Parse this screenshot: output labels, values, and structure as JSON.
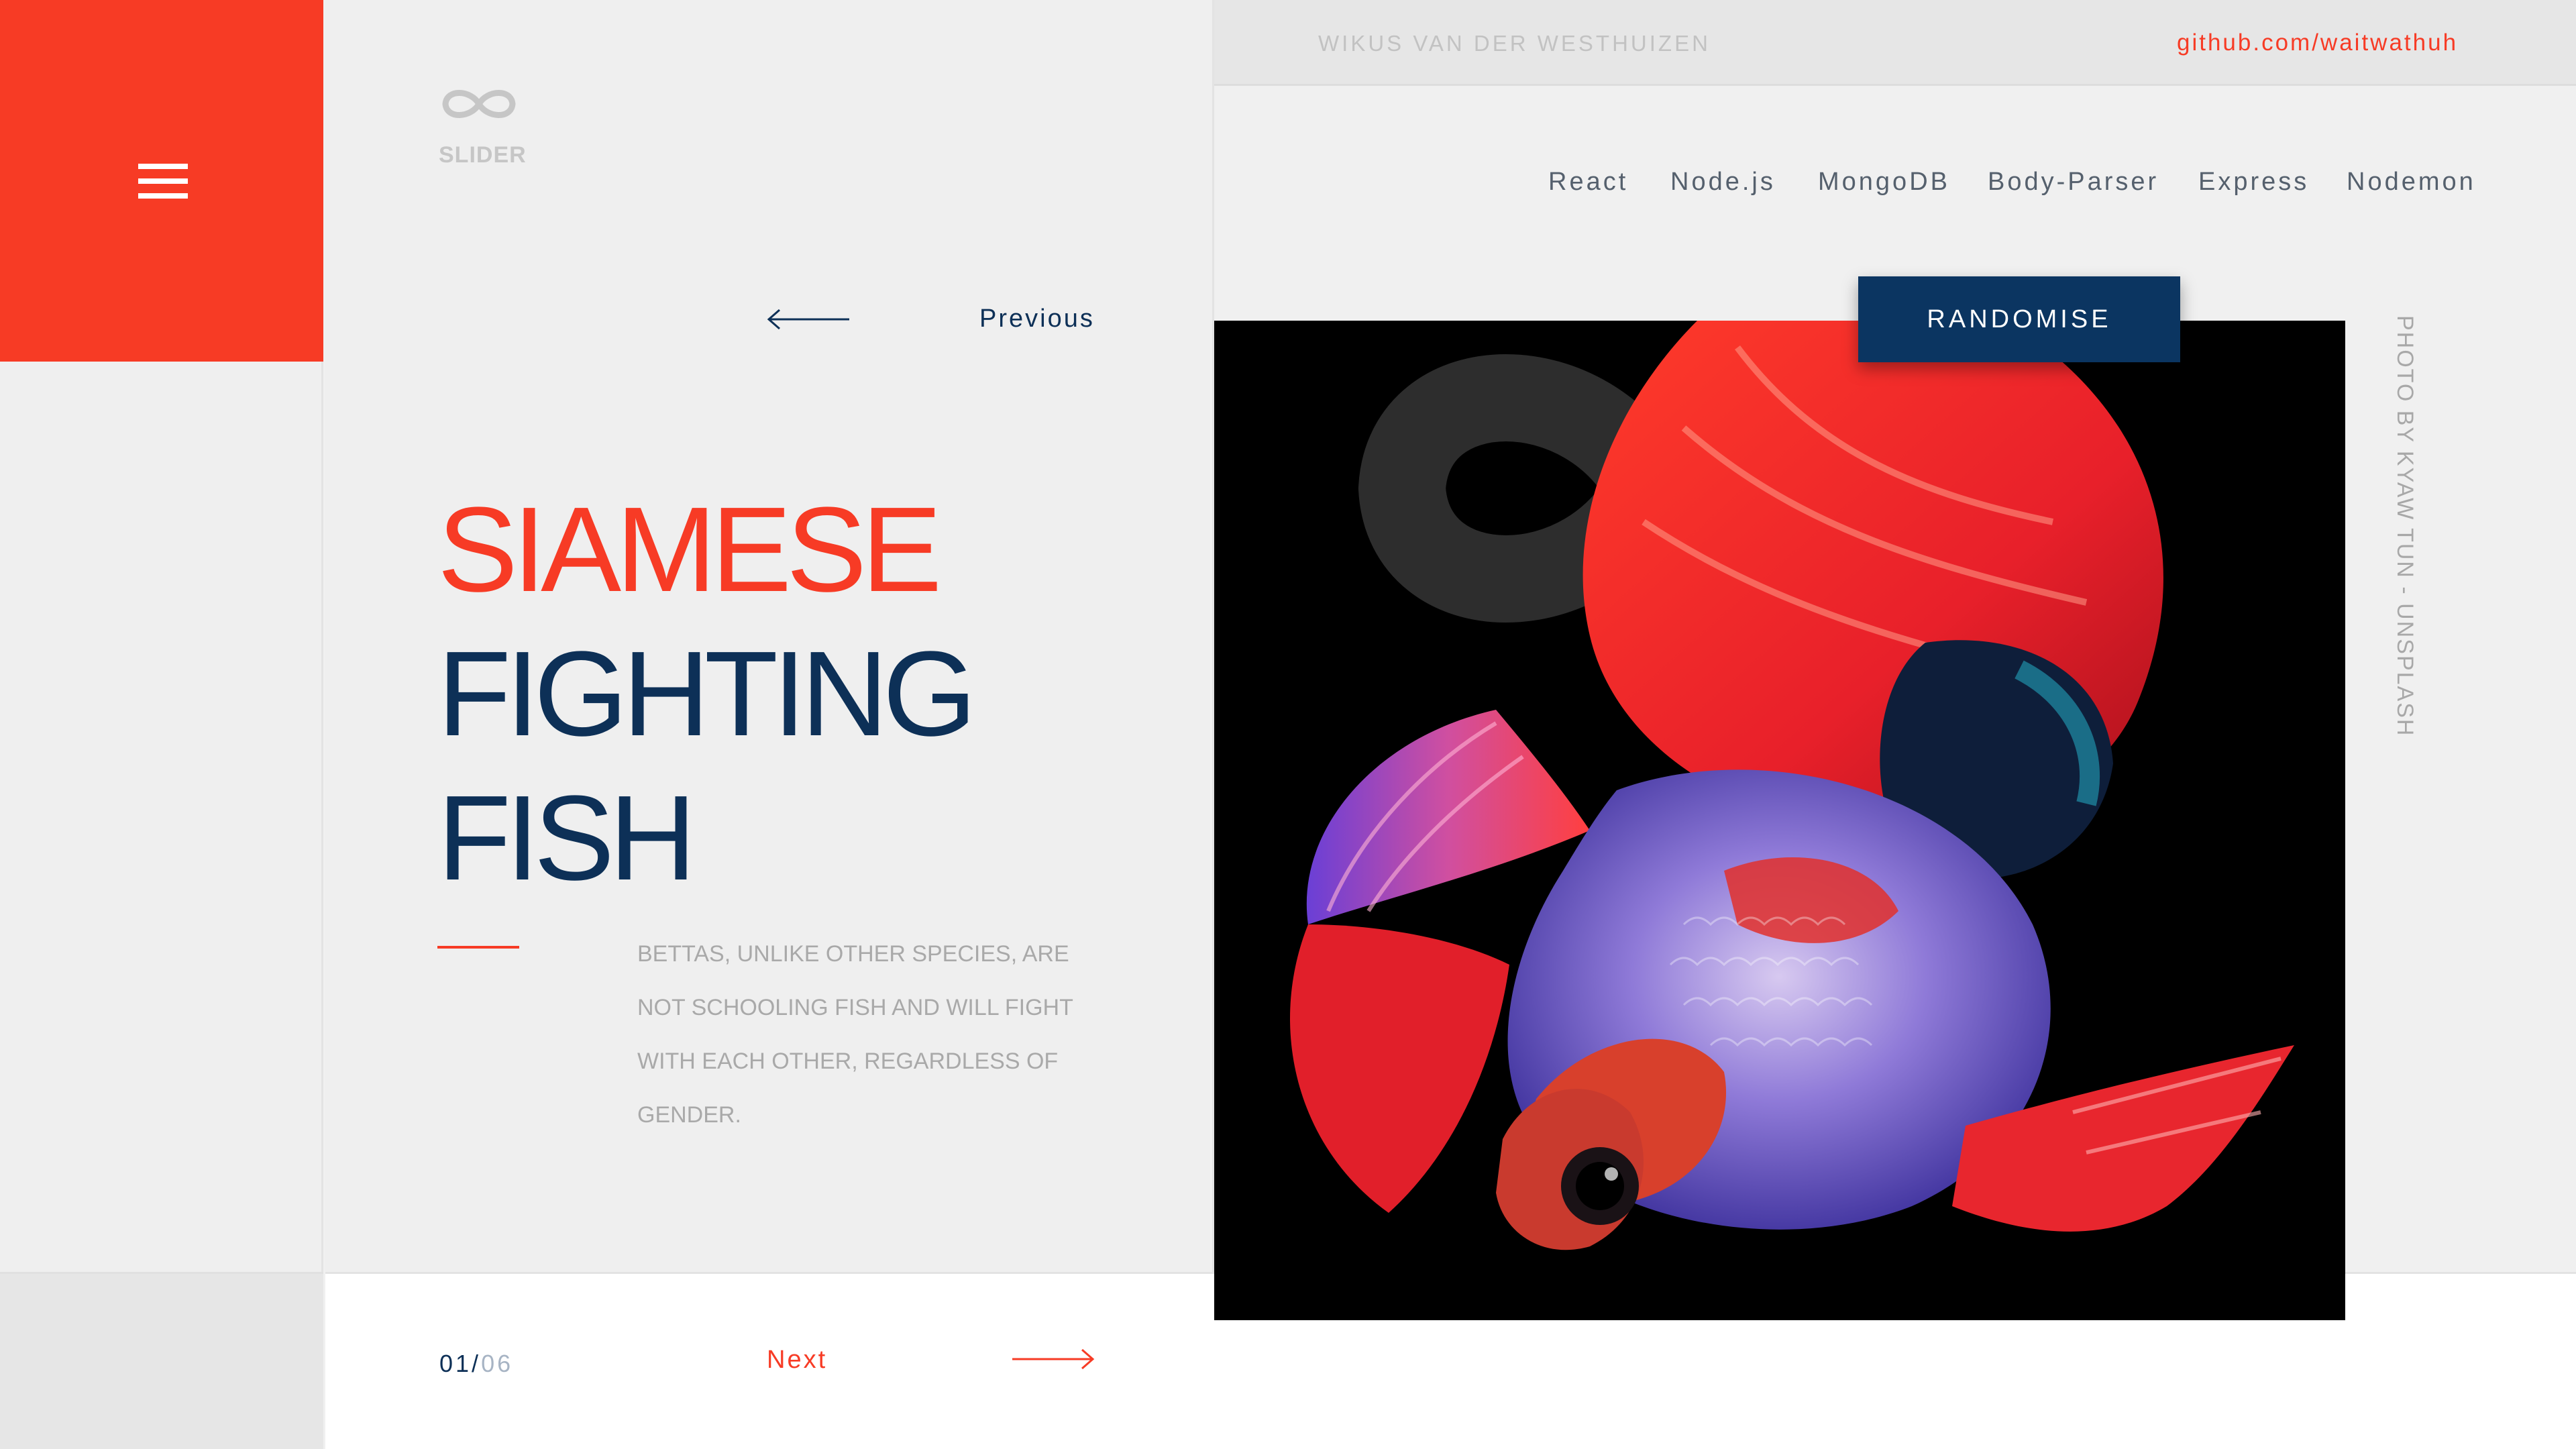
{
  "menu": {
    "icon": "hamburger-menu-icon"
  },
  "logo": {
    "icon": "infinity-icon",
    "text": "SLIDER"
  },
  "header": {
    "author": "WIKUS VAN DER WESTHUIZEN",
    "github": "github.com/waitwathuh"
  },
  "nav": {
    "items": [
      "React",
      "Node.js",
      "MongoDB",
      "Body-Parser",
      "Express",
      "Nodemon"
    ]
  },
  "slider": {
    "previous_label": "Previous",
    "next_label": "Next",
    "title_lines": [
      "SIAMESE",
      "FIGHTING",
      "FISH"
    ],
    "description": "BETTAS, UNLIKE OTHER SPECIES, ARE NOT SCHOOLING FISH AND WILL FIGHT WITH EACH OTHER, REGARDLESS OF GENDER.",
    "current": "01",
    "separator": "/",
    "total": "06"
  },
  "randomise_label": "RANDOMISE",
  "photo_credit": "PHOTO BY KYAW TUN - UNSPLASH",
  "colors": {
    "accent": "#f73b25",
    "navy": "#0d3057",
    "button": "#0b3561",
    "background": "#efefef"
  }
}
